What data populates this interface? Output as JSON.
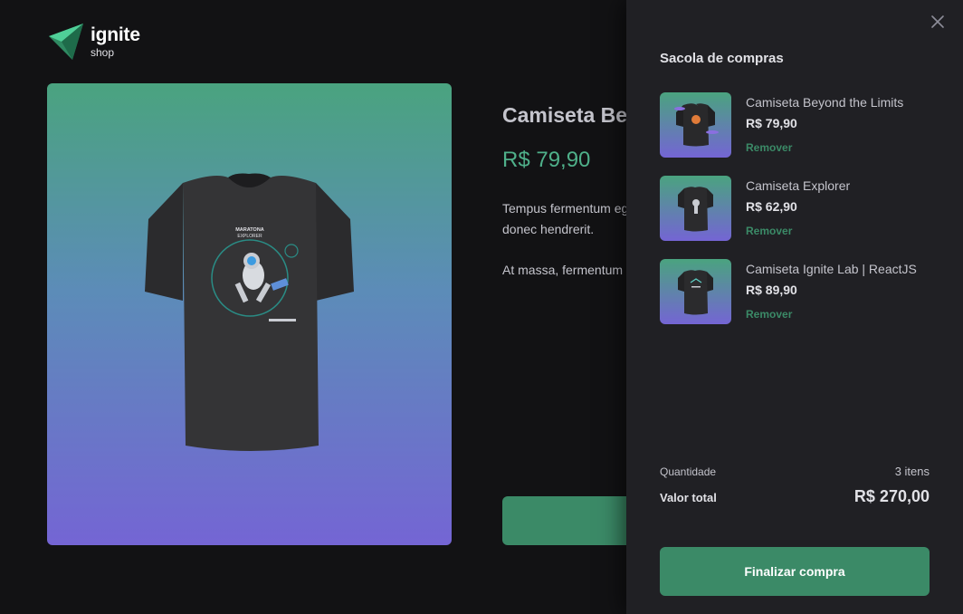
{
  "brand": {
    "name": "ignite",
    "sub": "shop"
  },
  "product": {
    "title": "Camiseta Beyond the Limits",
    "price": "R$ 79,90",
    "description": [
      "Tempus fermentum eget lacus, quis ridiculus amet. Bibendum metus donec hendrerit.",
      "At massa, fermentum Netus lorem nulla nulla."
    ],
    "print": {
      "line1": "MARATONA",
      "line2": "EXPLORER"
    }
  },
  "cart": {
    "title": "Sacola de compras",
    "items": [
      {
        "name": "Camiseta Beyond the Limits",
        "price": "R$ 79,90",
        "remove": "Remover"
      },
      {
        "name": "Camiseta Explorer",
        "price": "R$ 62,90",
        "remove": "Remover"
      },
      {
        "name": "Camiseta Ignite Lab | ReactJS",
        "price": "R$ 89,90",
        "remove": "Remover"
      }
    ],
    "quantity_label": "Quantidade",
    "quantity_value": "3 itens",
    "total_label": "Valor total",
    "total_value": "R$ 270,00",
    "checkout_label": "Finalizar compra"
  },
  "icons": {
    "close": "close-icon",
    "logo": "ignite-logo-icon"
  },
  "colors": {
    "accent": "#3b8a67",
    "price": "#4fb08a",
    "background": "#121214",
    "panel": "#202024"
  }
}
